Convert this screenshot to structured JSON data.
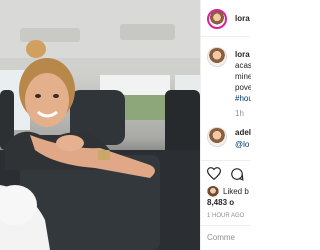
{
  "header": {
    "username": "lora"
  },
  "caption": {
    "username": "lora",
    "lines": [
      "acas",
      "mine",
      "pove",
      "#hou"
    ],
    "time_ago": "1h"
  },
  "comment": {
    "username": "adel",
    "line2": "@lo"
  },
  "actions": {
    "likes_label": "Liked b",
    "likes_count": "8,483 o"
  },
  "post_time": "1 HOUR AGO",
  "comment_input": {
    "placeholder": "Comme"
  }
}
